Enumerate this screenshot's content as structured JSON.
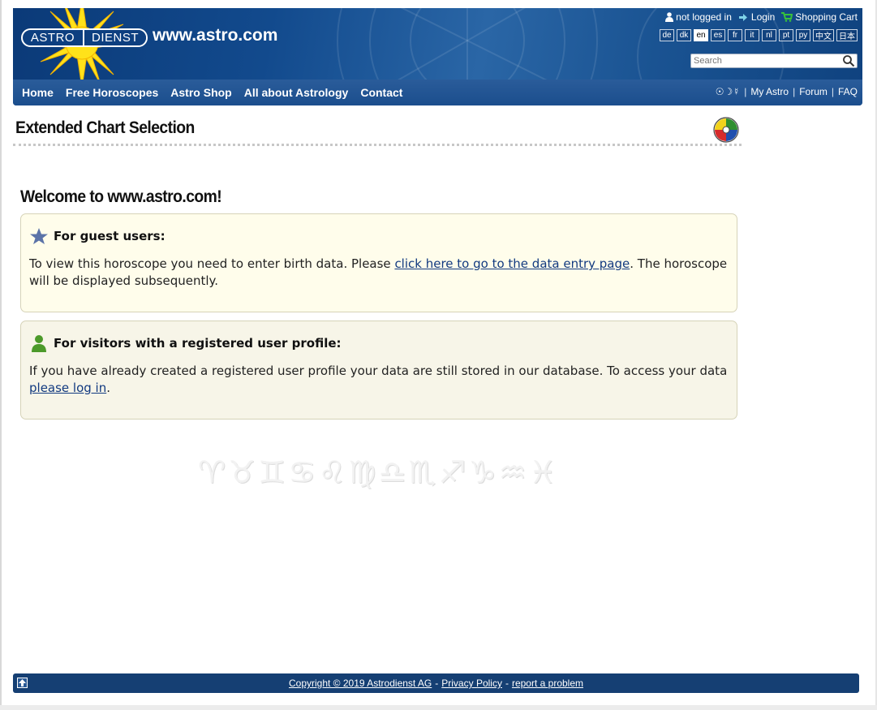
{
  "header": {
    "logo": {
      "left": "ASTRO",
      "right": "DIENST"
    },
    "site_url": "www.astro.com",
    "status": "not logged in",
    "login_label": "Login",
    "cart_label": "Shopping Cart",
    "languages": [
      "de",
      "dk",
      "en",
      "es",
      "fr",
      "it",
      "nl",
      "pt",
      "py",
      "中文",
      "日本"
    ],
    "active_language": "en",
    "search_placeholder": "Search"
  },
  "nav": {
    "items": [
      "Home",
      "Free Horoscopes",
      "Astro Shop",
      "All about Astrology",
      "Contact"
    ],
    "symbols": "☉☽☿",
    "my_astro": "My Astro",
    "forum": "Forum",
    "faq": "FAQ",
    "separator": "|"
  },
  "page": {
    "title": "Extended Chart Selection",
    "welcome": "Welcome to www.astro.com!"
  },
  "guest_panel": {
    "heading": "For guest users:",
    "text_before": "To view this horoscope you need to enter birth data. Please ",
    "link": "click here to go to the data entry page",
    "text_after": ". The horoscope will be displayed subsequently."
  },
  "registered_panel": {
    "heading": "For visitors with a registered user profile:",
    "text_before": "If you have already created a registered user profile your data are still stored in our database. To access your data ",
    "link": "please log in",
    "text_after": "."
  },
  "zodiac_glyphs": "♈♉♊♋♌♍♎♏♐♑♒♓",
  "footer": {
    "copyright": "Copyright © 2019 Astrodienst AG",
    "privacy": "Privacy Policy",
    "report": "report a problem",
    "dash": "-"
  },
  "colors": {
    "header_dark": "#0b3a78",
    "nav_bar": "#1b4e8d",
    "link": "#123a80",
    "panel_bg": "#fffdeb",
    "footer_bg": "#153f73",
    "star": "#5b73a8",
    "person": "#4c9a2a"
  }
}
